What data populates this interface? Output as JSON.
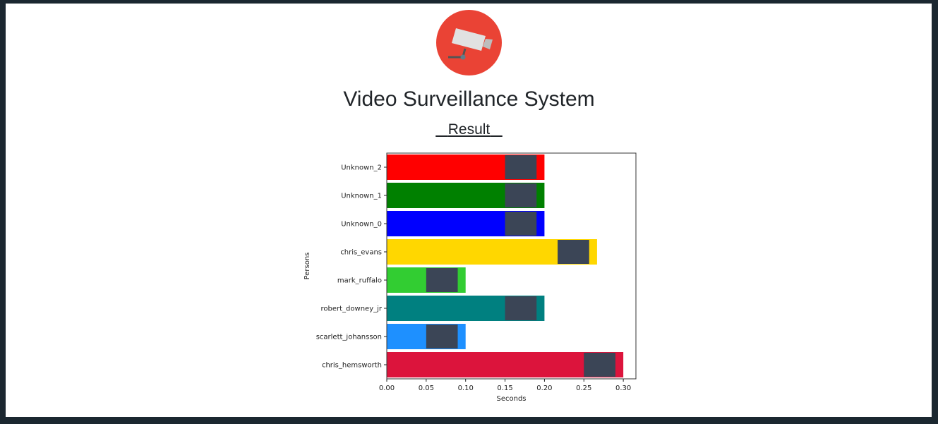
{
  "header": {
    "title": "Video Surveillance System",
    "subtitle": "Result",
    "logo_icon": "cctv-camera-icon"
  },
  "chart_data": {
    "type": "bar",
    "orientation": "horizontal",
    "categories": [
      "Unknown_2",
      "Unknown_1",
      "Unknown_0",
      "chris_evans",
      "mark_ruffalo",
      "robert_downey_jr",
      "scarlett_johansson",
      "chris_hemsworth"
    ],
    "values": [
      0.2,
      0.2,
      0.2,
      0.2667,
      0.1,
      0.2,
      0.1,
      0.3
    ],
    "colors": [
      "#ff0000",
      "#008000",
      "#0000ff",
      "#ffd700",
      "#32cd32",
      "#008080",
      "#1e90ff",
      "#dc143c"
    ],
    "xlabel": "Seconds",
    "ylabel": "Persons",
    "title": "",
    "xlim": [
      0,
      0.316
    ],
    "xticks": [
      "0.00",
      "0.05",
      "0.10",
      "0.15",
      "0.20",
      "0.25",
      "0.30"
    ],
    "grid": false,
    "annotations": "face thumbnail image at end of each bar"
  }
}
